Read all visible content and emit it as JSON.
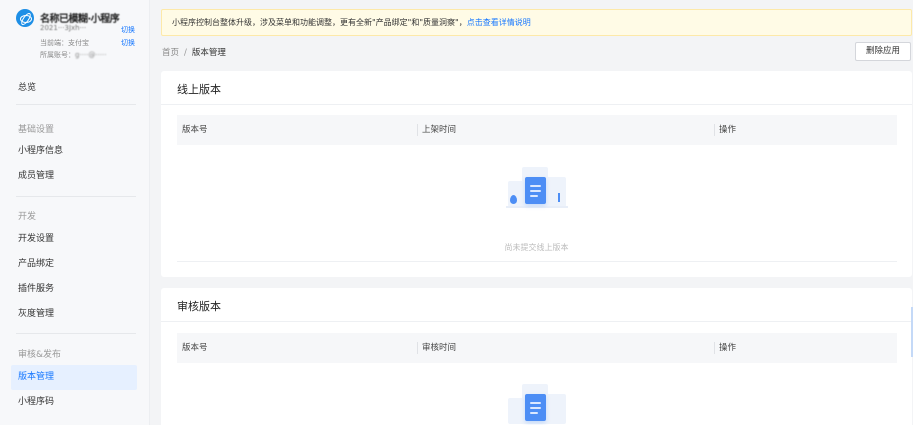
{
  "app": {
    "name": "名称已模糊·小程序",
    "id": "2021···3Jxh···",
    "current_end_label": "当前端：支付宝",
    "account_label": "所属账号：",
    "account_value": "g····@·····",
    "switch_label": "切换"
  },
  "nav": {
    "overview": "总览",
    "group_basic": "基础设置",
    "app_info": "小程序信息",
    "members": "成员管理",
    "group_dev": "开发",
    "dev_settings": "开发设置",
    "product_binding": "产品绑定",
    "plugins": "插件服务",
    "gray": "灰度管理",
    "group_release": "审核&发布",
    "version_mgmt": "版本管理",
    "qrcode": "小程序码"
  },
  "notice": {
    "text": "小程序控制台整体升级，涉及菜单和功能调整，更有全新\"产品绑定\"和\"质量洞察\"，",
    "link": "点击查看详情说明"
  },
  "breadcrumb": {
    "home": "首页",
    "separator": "/",
    "current": "版本管理"
  },
  "actions": {
    "delete_app": "删除应用"
  },
  "online": {
    "title": "线上版本",
    "columns": [
      "版本号",
      "上架时间",
      "操作"
    ],
    "empty": "尚未提交线上版本"
  },
  "review": {
    "title": "审核版本",
    "columns": [
      "版本号",
      "审核时间",
      "操作"
    ]
  }
}
